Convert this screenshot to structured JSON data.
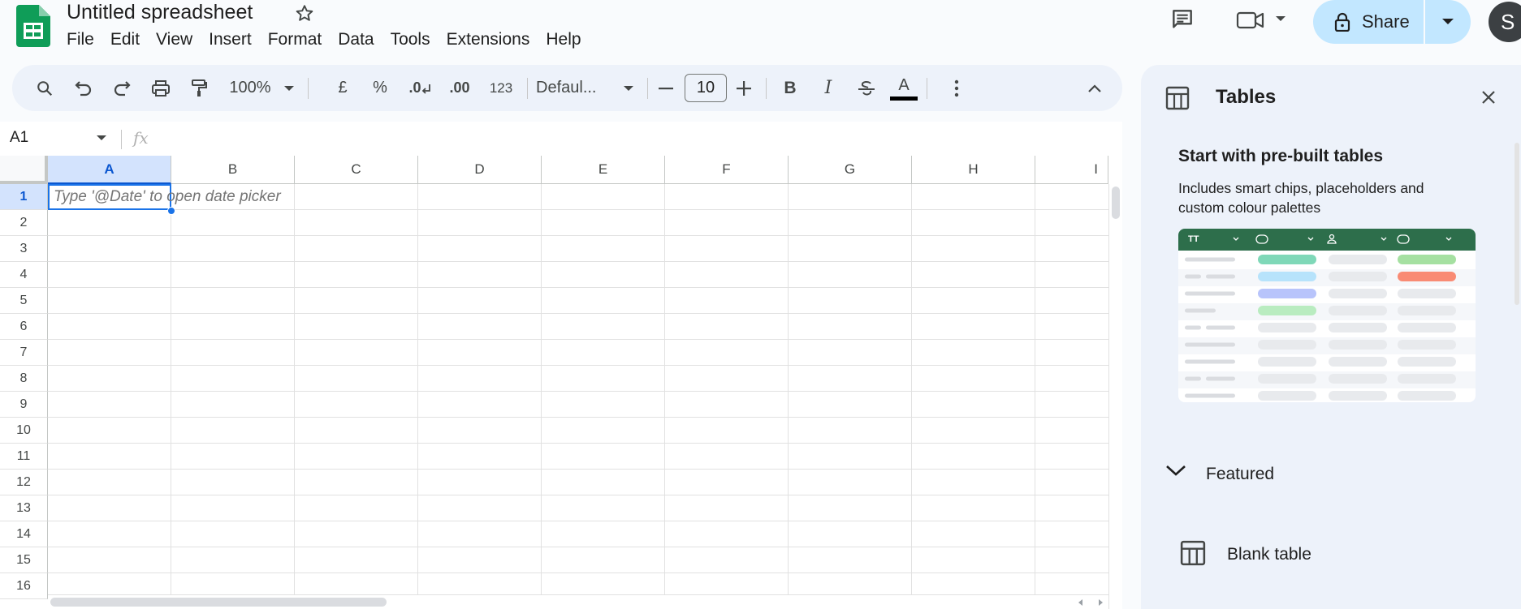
{
  "app": {
    "doc_title": "Untitled spreadsheet",
    "menu": [
      "File",
      "Edit",
      "View",
      "Insert",
      "Format",
      "Data",
      "Tools",
      "Extensions",
      "Help"
    ],
    "share_label": "Share",
    "avatar_initial": "S"
  },
  "toolbar": {
    "zoom": "100%",
    "currency": "£",
    "percent": "%",
    "decrease_decimal": ".0",
    "increase_decimal": ".00",
    "number_format": "123",
    "font": "Defaul...",
    "font_size": "10",
    "bold": "B",
    "italic": "I",
    "text_color": "A"
  },
  "formula_bar": {
    "name_box": "A1",
    "fx": "fx",
    "content": ""
  },
  "grid": {
    "columns": [
      "A",
      "B",
      "C",
      "D",
      "E",
      "F",
      "G",
      "H",
      "I"
    ],
    "rows": [
      "1",
      "2",
      "3",
      "4",
      "5",
      "6",
      "7",
      "8",
      "9",
      "10",
      "11",
      "12",
      "13",
      "14",
      "15",
      "16"
    ],
    "selected_cell": "A1",
    "a1_placeholder": "Type '@Date' to open date picker"
  },
  "panel": {
    "title": "Tables",
    "section_heading": "Start with pre-built tables",
    "section_desc": "Includes smart chips, placeholders and custom colour palettes",
    "preview_header": "TT",
    "featured_label": "Featured",
    "blank_table_label": "Blank table"
  },
  "colors": {
    "accent": "#1a73e8",
    "share_bg": "#c2e7ff",
    "sheets_green": "#0f9d58",
    "preview_header": "#2d6e4b"
  }
}
